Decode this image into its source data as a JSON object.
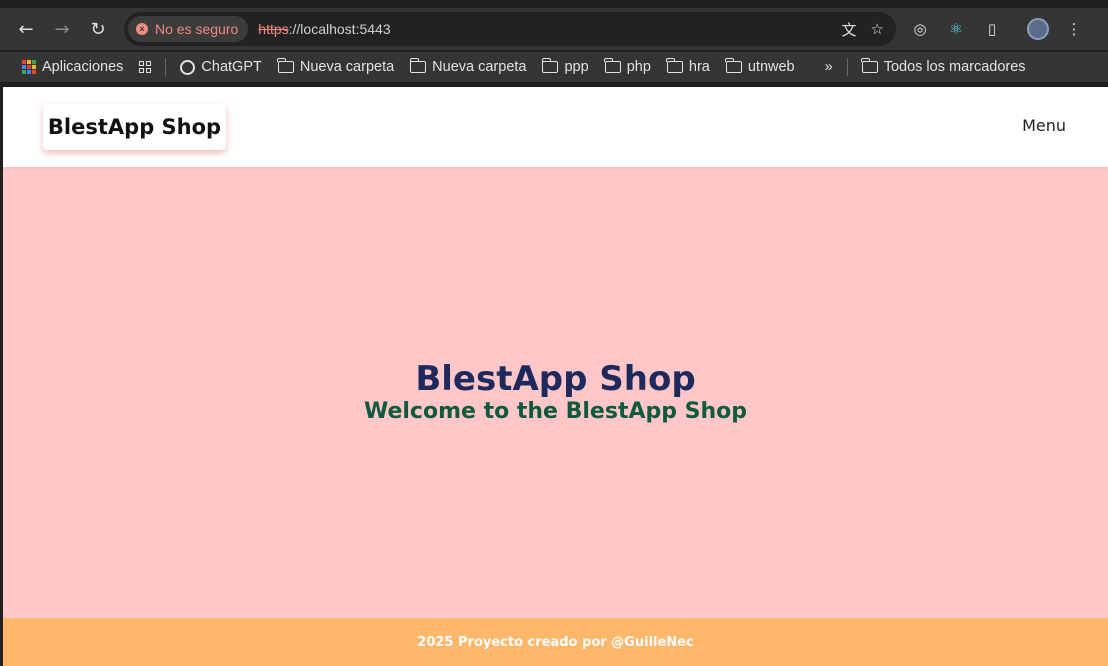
{
  "browser": {
    "security_chip": "No es seguro",
    "url_scheme": "https",
    "url_rest": "://localhost:5443",
    "icons": {
      "back": "arrow-left-icon",
      "forward": "arrow-right-icon",
      "reload": "reload-icon",
      "translate": "translate-icon",
      "bookmark_star": "star-icon",
      "extension1": "target-icon",
      "react": "react-icon",
      "extensions": "puzzle-icon",
      "more": "more-vert-icon"
    }
  },
  "bookmarks": {
    "apps_label": "Aplicaciones",
    "items": [
      {
        "label": "ChatGPT",
        "icon": "chatgpt-icon"
      },
      {
        "label": "Nueva carpeta",
        "icon": "folder-icon"
      },
      {
        "label": "Nueva carpeta",
        "icon": "folder-icon"
      },
      {
        "label": "ppp",
        "icon": "folder-icon"
      },
      {
        "label": "php",
        "icon": "folder-icon"
      },
      {
        "label": "hra",
        "icon": "folder-icon"
      },
      {
        "label": "utnweb",
        "icon": "folder-icon"
      }
    ],
    "overflow": "»",
    "all_bookmarks": "Todos los marcadores"
  },
  "site": {
    "brand": "BlestApp Shop",
    "menu": "Menu",
    "hero_title": "BlestApp Shop",
    "hero_subtitle": "Welcome to the BlestApp Shop",
    "footer": "2025 Proyecto creado por @GuilleNec"
  },
  "colors": {
    "page_background": "#ffc7c8",
    "footer_background": "#ffb86b",
    "hero_title": "#1e2a5e",
    "hero_subtitle": "#0f5a3e",
    "insecure": "#f28b82"
  }
}
